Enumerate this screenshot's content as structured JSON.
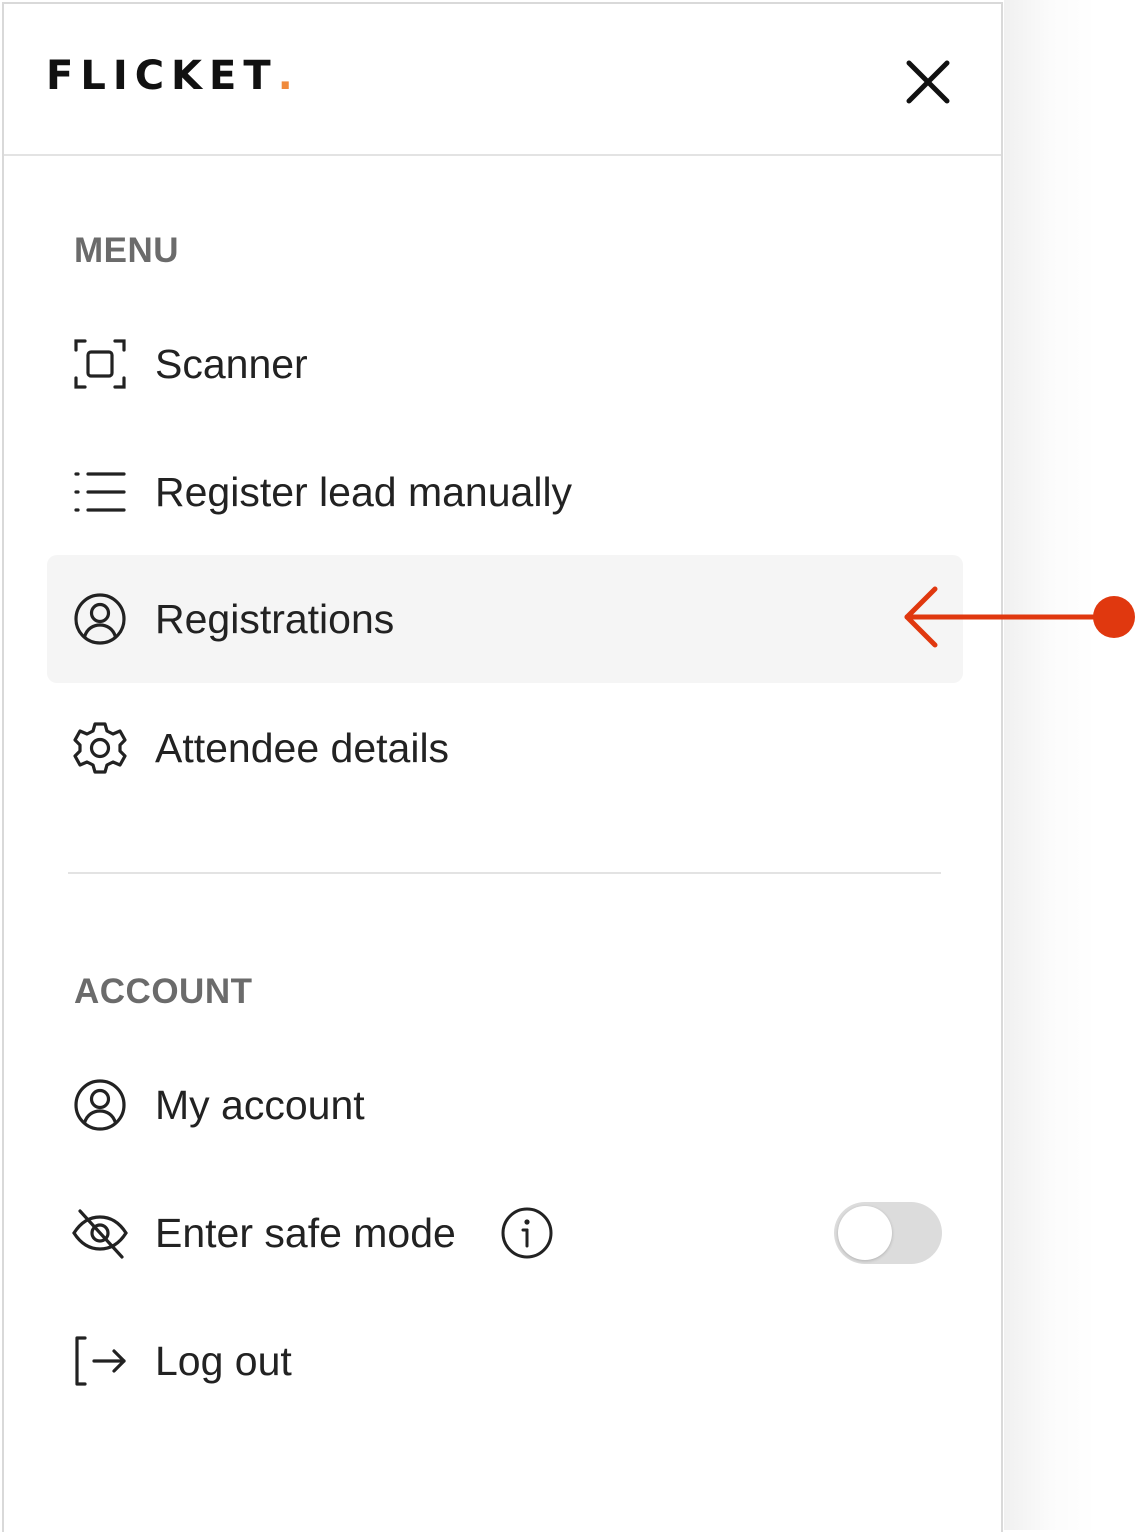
{
  "brand": {
    "logo_text": "FLICKET",
    "logo_dot": ".",
    "accent_color": "#f08a3c"
  },
  "header": {
    "close_icon": "close-icon"
  },
  "menu": {
    "section_label": "MENU",
    "items": [
      {
        "label": "Scanner",
        "icon": "scan-icon",
        "active": false
      },
      {
        "label": "Register lead manually",
        "icon": "list-icon",
        "active": false
      },
      {
        "label": "Registrations",
        "icon": "user-circle-icon",
        "active": true
      },
      {
        "label": "Attendee details",
        "icon": "gear-icon",
        "active": false
      }
    ]
  },
  "account": {
    "section_label": "ACCOUNT",
    "items": [
      {
        "label": "My account",
        "icon": "user-circle-icon"
      },
      {
        "label": "Enter safe mode",
        "icon": "eye-off-icon",
        "info_icon": "info-icon",
        "toggle_on": false
      },
      {
        "label": "Log out",
        "icon": "logout-icon"
      }
    ]
  },
  "annotation": {
    "color": "#e0380f",
    "icon": "arrow-left-pointer"
  }
}
